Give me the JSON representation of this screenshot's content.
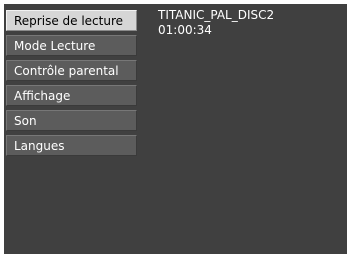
{
  "menu": {
    "items": [
      {
        "label": "Reprise de lecture",
        "selected": true
      },
      {
        "label": "Mode Lecture",
        "selected": false
      },
      {
        "label": "Contrôle parental",
        "selected": false
      },
      {
        "label": "Affichage",
        "selected": false
      },
      {
        "label": "Son",
        "selected": false
      },
      {
        "label": "Langues",
        "selected": false
      }
    ]
  },
  "disc": {
    "title": "TITANIC_PAL_DISC2",
    "time": "01:00:34"
  },
  "colors": {
    "screen_background": "#404040",
    "menu_item_background": "#5c5c5c",
    "selected_item_background": "#d6d6d6",
    "text": "#ffffff",
    "selected_text": "#000000"
  }
}
